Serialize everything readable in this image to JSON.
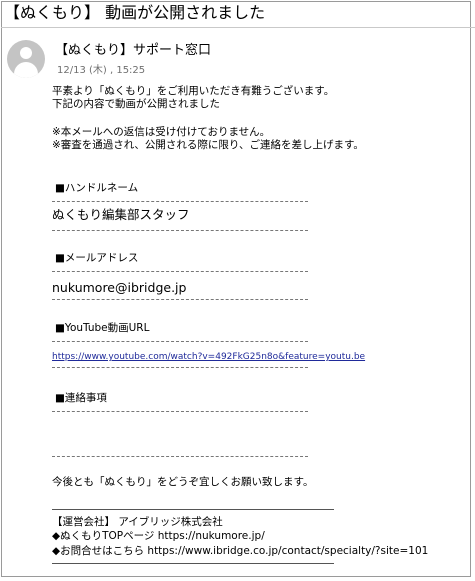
{
  "email": {
    "subject": "【ぬくもり】 動画が公開されました",
    "sender": "【ぬくもり】サポート窓口",
    "date": "12/13 (木) , 15:25"
  },
  "body": {
    "greeting1": "平素より「ぬくもり」をご利用いただき有難うございます。",
    "greeting2": "下記の内容で動画が公開されました",
    "note1": "※本メールへの返信は受け付けておりません。",
    "note2": "※審査を通過され、公開される際に限り、ご連絡を差し上げます。",
    "handle_label": "■ハンドルネーム",
    "handle_value": "ぬくもり編集部スタッフ",
    "mail_label": "■メールアドレス",
    "mail_value": "nukumore@ibridge.jp",
    "youtube_label": "■YouTube動画URL",
    "youtube_url": "https://www.youtube.com/watch?v=492FkG25n8o&feature=youtu.be",
    "contact_label": "■連絡事項",
    "closing": "今後とも「ぬくもり」をどうぞ宜しくお願い致します。"
  },
  "footer": {
    "company": "【運営会社】 アイブリッジ株式会社",
    "top_page": "◆ぬくもりTOPページ  https://nukumore.jp/",
    "inquiry": "◆お問合せはこちら  https://www.ibridge.co.jp/contact/specialty/?site=101"
  }
}
